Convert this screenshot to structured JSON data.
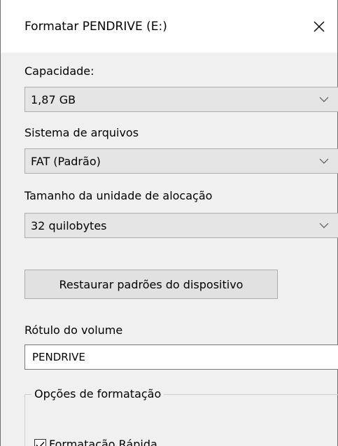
{
  "window": {
    "title": "Formatar PENDRIVE (E:)",
    "close_icon": "close-icon"
  },
  "capacity": {
    "label": "Capacidade:",
    "value": "1,87 GB"
  },
  "file_system": {
    "label": "Sistema de arquivos",
    "value": "FAT (Padrão)"
  },
  "allocation": {
    "label": "Tamanho da unidade de alocação",
    "value": "32 quilobytes"
  },
  "restore_button": {
    "label": "Restaurar padrões do dispositivo"
  },
  "volume_label": {
    "label": "Rótulo do volume",
    "value": "PENDRIVE"
  },
  "format_options": {
    "legend": "Opções de formatação",
    "quick_format_label": "Formatação Rápida",
    "quick_format_checked": true
  },
  "colors": {
    "dialog_bg": "#f0f0f0",
    "title_bg": "#ffffff",
    "select_bg": "#e5e5e5",
    "button_bg": "#e1e1e1",
    "border": "#adadad"
  }
}
